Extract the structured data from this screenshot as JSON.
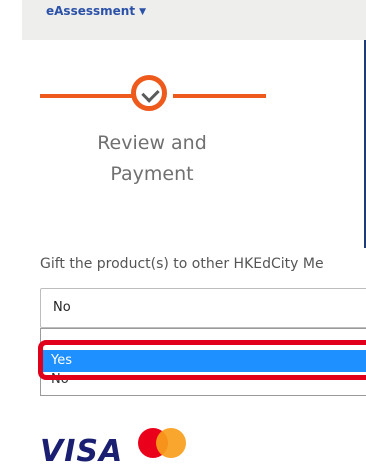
{
  "nav": {
    "menu_label": "eAssessment",
    "menu_icon": "chevron-down-icon"
  },
  "stepper": {
    "step_label": "Review and Payment",
    "step_status": "completed",
    "step_icon": "checkmark-icon",
    "accent_color": "#ee5a1c"
  },
  "gift": {
    "question": "Gift the product(s) to other HKEdCity Me",
    "selected_value": "No",
    "options": [
      "",
      "Yes",
      "No"
    ],
    "highlighted_option": "Yes",
    "highlight_color": "#1e90ff",
    "annotation_color": "#e0001b"
  },
  "payment": {
    "visa_label": "VISA",
    "mastercard_icon": "mastercard-icon"
  }
}
